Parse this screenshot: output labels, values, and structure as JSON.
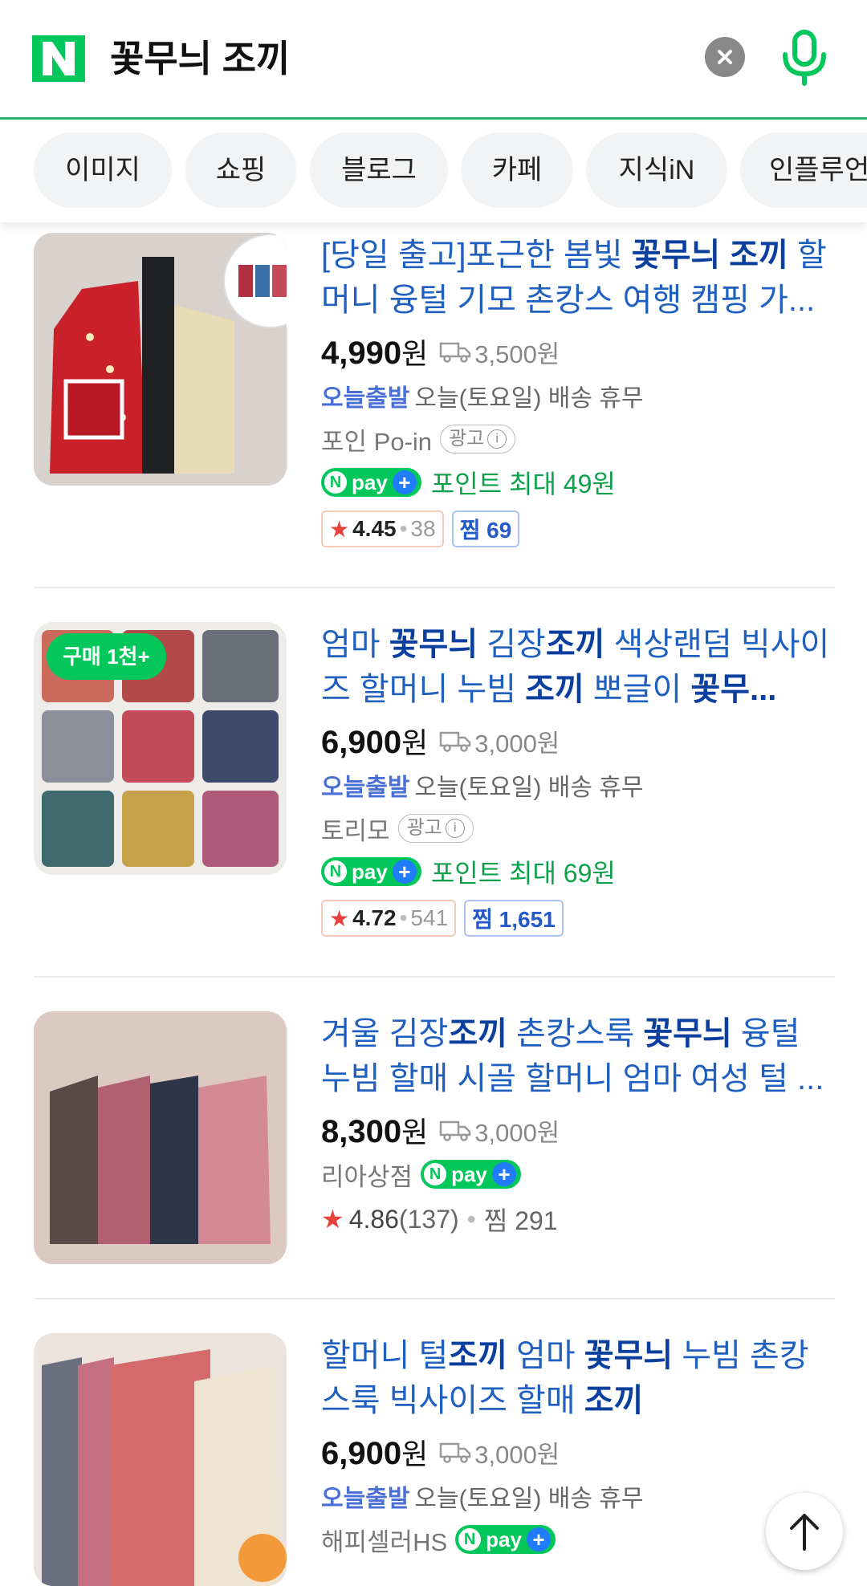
{
  "search": {
    "query": "꽃무늬 조끼",
    "clear_icon": "close-icon",
    "mic_icon": "microphone-icon",
    "logo_letter": "N"
  },
  "tabs": [
    "이미지",
    "쇼핑",
    "블로그",
    "카페",
    "지식iN",
    "인플루언서"
  ],
  "products": [
    {
      "title_parts": [
        [
          "[당일 출고]포근한 봄빛 ",
          false
        ],
        [
          "꽃무늬 조끼",
          true
        ],
        [
          " 할머니 융털 기모 촌캉스 여행 캠핑 가...",
          false
        ]
      ],
      "price": "4,990",
      "price_unit": "원",
      "shipping": "3,500원",
      "today_label": "오늘출발",
      "today_text": "오늘(토요일) 배송 휴무",
      "seller": "포인 Po-in",
      "ad_label": "광고",
      "npay": true,
      "point_text": "포인트 최대 49원",
      "rating": "4.45",
      "review_count": "38",
      "zzim": "찜 69"
    },
    {
      "badge": "구매 1천+",
      "title_parts": [
        [
          "엄마 ",
          false
        ],
        [
          "꽃무늬",
          true
        ],
        [
          " 김장",
          false
        ],
        [
          "조끼",
          true
        ],
        [
          " 색상랜덤 빅사이즈 할머니 누빔 ",
          false
        ],
        [
          "조끼",
          true
        ],
        [
          " 뽀글이 ",
          false
        ],
        [
          "꽃무...",
          true
        ]
      ],
      "price": "6,900",
      "price_unit": "원",
      "shipping": "3,000원",
      "today_label": "오늘출발",
      "today_text": "오늘(토요일) 배송 휴무",
      "seller": "토리모",
      "ad_label": "광고",
      "npay": true,
      "point_text": "포인트 최대 69원",
      "rating": "4.72",
      "review_count": "541",
      "zzim": "찜 1,651"
    },
    {
      "title_parts": [
        [
          "겨울 김장",
          false
        ],
        [
          "조끼",
          true
        ],
        [
          " 촌캉스룩 ",
          false
        ],
        [
          "꽃무늬",
          true
        ],
        [
          " 융털 누빔 할매 시골 할머니 엄마 여성 털 ...",
          false
        ]
      ],
      "price": "8,300",
      "price_unit": "원",
      "shipping": "3,000원",
      "seller": "리아상점",
      "npay": true,
      "rating": "4.86",
      "review_count": "(137)",
      "zzim": "찜 291"
    },
    {
      "title_parts": [
        [
          "할머니 털",
          false
        ],
        [
          "조끼",
          true
        ],
        [
          " 엄마 ",
          false
        ],
        [
          "꽃무늬",
          true
        ],
        [
          " 누빔 촌캉스룩 빅사이즈 할매 ",
          false
        ],
        [
          "조끼",
          true
        ]
      ],
      "price": "6,900",
      "price_unit": "원",
      "shipping": "3,000원",
      "today_label": "오늘출발",
      "today_text": "오늘(토요일) 배송 휴무",
      "seller": "해피셀러HS",
      "npay": true
    }
  ],
  "npay_label": "pay",
  "ad_info_icon": "info-icon",
  "scroll_top_icon": "arrow-up-icon",
  "colors": {
    "naver_green": "#03c75a",
    "title_blue": "#1f5fbf",
    "today_blue": "#4a6fd6",
    "point_green": "#0ca04a",
    "star_red": "#e9423d"
  }
}
